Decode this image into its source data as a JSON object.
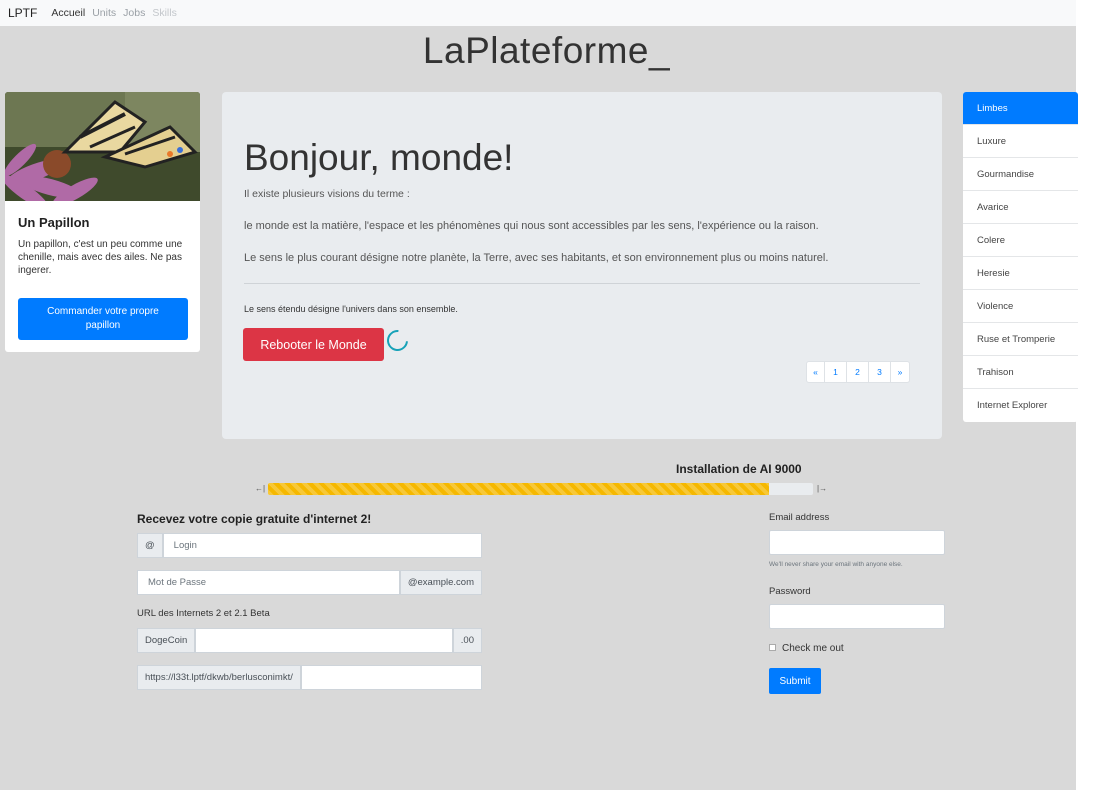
{
  "navbar": {
    "brand": "LPTF",
    "links": [
      {
        "label": "Accueil"
      },
      {
        "label": "Units"
      },
      {
        "label": "Jobs"
      },
      {
        "label": "Skills"
      }
    ]
  },
  "site_title": "LaPlateforme_",
  "card": {
    "image_alt": "butterfly on pink flower",
    "title": "Un Papillon",
    "text": "Un papillon, c'est un peu comme une chenille, mais avec des ailes. Ne pas ingerer.",
    "button": "Commander votre propre papillon"
  },
  "jumbotron": {
    "title": "Bonjour, monde!",
    "lead1": "Il existe plusieurs visions du terme :",
    "lead2": "le monde est la matière, l'espace et les phénomènes qui nous sont accessibles par les sens, l'expérience ou la raison.",
    "lead3": "Le sens le plus courant désigne notre planète, la Terre, avec ses habitants, et son environnement plus ou moins naturel.",
    "small": "Le sens étendu désigne l'univers dans son ensemble.",
    "button": "Rebooter le Monde",
    "pagination": [
      "«",
      "1",
      "2",
      "3",
      "»"
    ]
  },
  "list_group": [
    "Limbes",
    "Luxure",
    "Gourmandise",
    "Avarice",
    "Colere",
    "Heresie",
    "Violence",
    "Ruse et Tromperie",
    "Trahison",
    "Internet Explorer"
  ],
  "progress": {
    "label": "Installation de AI 9000",
    "left_marker": "←|",
    "right_marker": "|→",
    "value_percent": 92,
    "color": "#f5b800"
  },
  "form1": {
    "heading": "Recevez votre copie gratuite d'internet 2!",
    "login_addon": "@",
    "login_placeholder": "Login",
    "password_placeholder": "Mot de Passe",
    "password_addon": "@example.com",
    "url_label": "URL des Internets 2 et 2.1 Beta",
    "currency_addon": "DogeCoin",
    "currency_suffix": ".00",
    "url_addon": "https://l33t.lptf/dkwb/berlusconimkt/"
  },
  "form2": {
    "email_label": "Email address",
    "email_help": "We'll never share your email with anyone else.",
    "password_label": "Password",
    "check_label": "Check me out",
    "submit": "Submit"
  },
  "colors": {
    "primary": "#007bff",
    "danger": "#dc3545",
    "spinner": "#17a2b8",
    "background": "#d9d9d9"
  }
}
